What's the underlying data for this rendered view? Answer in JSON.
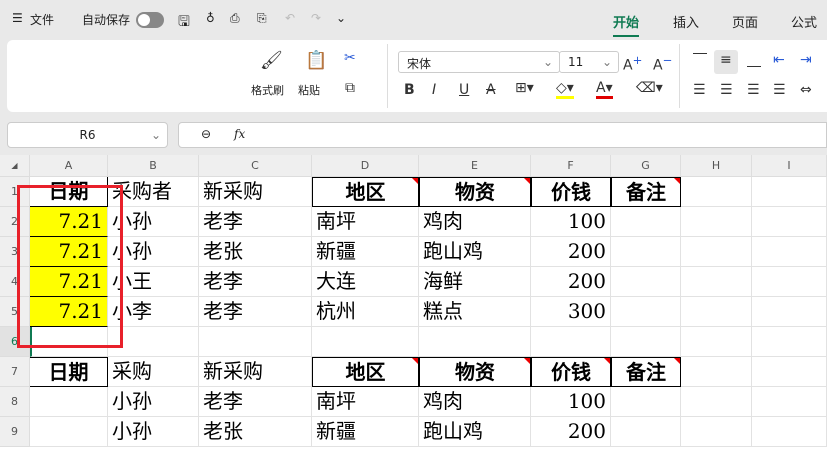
{
  "titlebar": {
    "menu_icon": "hamburger-icon",
    "file": "文件",
    "autosave": "自动保存",
    "autosave_on": false,
    "icons": [
      "save-icon",
      "share-icon",
      "print-icon",
      "print-preview-icon",
      "undo-icon",
      "redo-icon",
      "more-chevron-icon"
    ]
  },
  "tabs": [
    {
      "label": "开始",
      "active": true
    },
    {
      "label": "插入"
    },
    {
      "label": "页面"
    },
    {
      "label": "公式"
    }
  ],
  "ribbon": {
    "format_painter": "格式刷",
    "paste": "粘贴",
    "font_name": "宋体",
    "font_size": "11",
    "highlight_color": "#ffff00",
    "font_color": "#e00000"
  },
  "formula_bar": {
    "name_box": "R6",
    "fx": "fx",
    "value": ""
  },
  "columns": [
    "A",
    "B",
    "C",
    "D",
    "E",
    "F",
    "G",
    "H",
    "I"
  ],
  "rows": [
    "1",
    "2",
    "3",
    "4",
    "5",
    "6",
    "7",
    "8",
    "9"
  ],
  "cells": [
    [
      "日期",
      "采购者",
      "新采购",
      "地区",
      "物资",
      "价钱",
      "备注",
      "",
      ""
    ],
    [
      "7.21",
      "小孙",
      "老李",
      "南坪",
      "鸡肉",
      "100",
      "",
      "",
      ""
    ],
    [
      "7.21",
      "小孙",
      "老张",
      "新疆",
      "跑山鸡",
      "200",
      "",
      "",
      ""
    ],
    [
      "7.21",
      "小王",
      "老李",
      "大连",
      "海鲜",
      "200",
      "",
      "",
      ""
    ],
    [
      "7.21",
      "小李",
      "老李",
      "杭州",
      "糕点",
      "300",
      "",
      "",
      ""
    ],
    [
      "",
      "",
      "",
      "",
      "",
      "",
      "",
      "",
      ""
    ],
    [
      "日期",
      "采购",
      "新采购",
      "地区",
      "物资",
      "价钱",
      "备注",
      "",
      ""
    ],
    [
      "",
      "小孙",
      "老李",
      "南坪",
      "鸡肉",
      "100",
      "",
      "",
      ""
    ],
    [
      "",
      "小孙",
      "老张",
      "新疆",
      "跑山鸡",
      "200",
      "",
      "",
      ""
    ]
  ],
  "colors": {
    "accent": "#0f7a52",
    "highlight_box": "#e8202a",
    "fill": "#ffff00"
  }
}
